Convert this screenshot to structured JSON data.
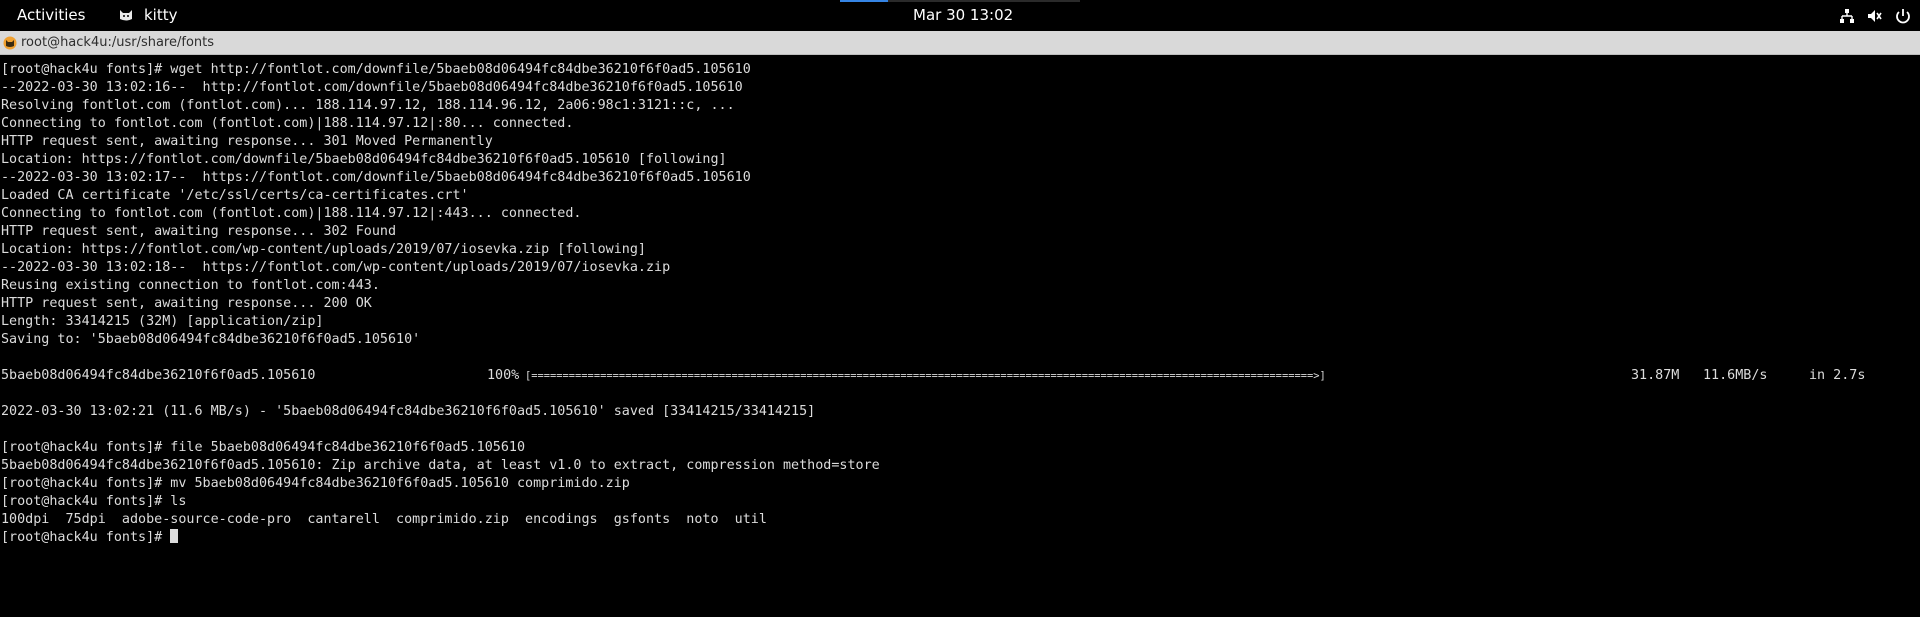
{
  "topbar": {
    "activities": "Activities",
    "app_name": "kitty",
    "clock": "Mar 30  13:02",
    "icons": [
      "network-icon",
      "volume-icon",
      "power-icon"
    ]
  },
  "window": {
    "title": "root@hack4u:/usr/share/fonts"
  },
  "terminal": {
    "lines": [
      "[root@hack4u fonts]# wget http://fontlot.com/downfile/5baeb08d06494fc84dbe36210f6f0ad5.105610",
      "--2022-03-30 13:02:16--  http://fontlot.com/downfile/5baeb08d06494fc84dbe36210f6f0ad5.105610",
      "Resolving fontlot.com (fontlot.com)... 188.114.97.12, 188.114.96.12, 2a06:98c1:3121::c, ...",
      "Connecting to fontlot.com (fontlot.com)|188.114.97.12|:80... connected.",
      "HTTP request sent, awaiting response... 301 Moved Permanently",
      "Location: https://fontlot.com/downfile/5baeb08d06494fc84dbe36210f6f0ad5.105610 [following]",
      "--2022-03-30 13:02:17--  https://fontlot.com/downfile/5baeb08d06494fc84dbe36210f6f0ad5.105610",
      "Loaded CA certificate '/etc/ssl/certs/ca-certificates.crt'",
      "Connecting to fontlot.com (fontlot.com)|188.114.97.12|:443... connected.",
      "HTTP request sent, awaiting response... 302 Found",
      "Location: https://fontlot.com/wp-content/uploads/2019/07/iosevka.zip [following]",
      "--2022-03-30 13:02:18--  https://fontlot.com/wp-content/uploads/2019/07/iosevka.zip",
      "Reusing existing connection to fontlot.com:443.",
      "HTTP request sent, awaiting response... 200 OK",
      "Length: 33414215 (32M) [application/zip]",
      "Saving to: '5baeb08d06494fc84dbe36210f6f0ad5.105610'",
      ""
    ],
    "progress": {
      "filename": "5baeb08d06494fc84dbe36210f6f0ad5.105610",
      "percent": "100%",
      "bar": "[=============================================================================================================================>]",
      "size": "31.87M",
      "speed": "11.6MB/s",
      "eta": "in 2.7s"
    },
    "lines_after": [
      "",
      "2022-03-30 13:02:21 (11.6 MB/s) - '5baeb08d06494fc84dbe36210f6f0ad5.105610' saved [33414215/33414215]",
      "",
      "[root@hack4u fonts]# file 5baeb08d06494fc84dbe36210f6f0ad5.105610",
      "5baeb08d06494fc84dbe36210f6f0ad5.105610: Zip archive data, at least v1.0 to extract, compression method=store",
      "[root@hack4u fonts]# mv 5baeb08d06494fc84dbe36210f6f0ad5.105610 comprimido.zip",
      "[root@hack4u fonts]# ls",
      "100dpi  75dpi  adobe-source-code-pro  cantarell  comprimido.zip  encodings  gsfonts  noto  util"
    ],
    "prompt": "[root@hack4u fonts]# "
  }
}
